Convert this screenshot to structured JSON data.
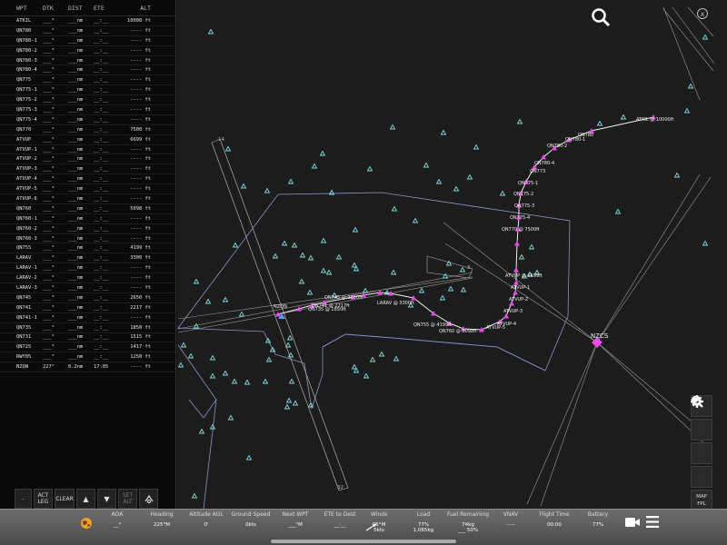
{
  "flight_plan": {
    "columns": [
      "WPT",
      "DTK",
      "DIST",
      "ETE",
      "ALT"
    ],
    "rows": [
      {
        "wpt": "ATKIL",
        "dtk": "___°",
        "dist": "___nm",
        "ete": "__:__",
        "alt": "10000 ft"
      },
      {
        "wpt": "QN780",
        "dtk": "___°",
        "dist": "___nm",
        "ete": "__:__",
        "alt": "---- ft"
      },
      {
        "wpt": "QN780-1",
        "dtk": "___°",
        "dist": "___nm",
        "ete": "__:__",
        "alt": "---- ft"
      },
      {
        "wpt": "QN780-2",
        "dtk": "___°",
        "dist": "___nm",
        "ete": "__:__",
        "alt": "---- ft"
      },
      {
        "wpt": "QN780-3",
        "dtk": "___°",
        "dist": "___nm",
        "ete": "__:__",
        "alt": "---- ft"
      },
      {
        "wpt": "QN780-4",
        "dtk": "___°",
        "dist": "___nm",
        "ete": "__:__",
        "alt": "---- ft"
      },
      {
        "wpt": "QN775",
        "dtk": "___°",
        "dist": "___nm",
        "ete": "__:__",
        "alt": "---- ft"
      },
      {
        "wpt": "QN775-1",
        "dtk": "___°",
        "dist": "___nm",
        "ete": "__:__",
        "alt": "---- ft"
      },
      {
        "wpt": "QN775-2",
        "dtk": "___°",
        "dist": "___nm",
        "ete": "__:__",
        "alt": "---- ft"
      },
      {
        "wpt": "QN775-3",
        "dtk": "___°",
        "dist": "___nm",
        "ete": "__:__",
        "alt": "---- ft"
      },
      {
        "wpt": "QN775-4",
        "dtk": "___°",
        "dist": "___nm",
        "ete": "__:__",
        "alt": "---- ft"
      },
      {
        "wpt": "QN770",
        "dtk": "___°",
        "dist": "___nm",
        "ete": "__:__",
        "alt": "7500 ft"
      },
      {
        "wpt": "ATVUP",
        "dtk": "___°",
        "dist": "___nm",
        "ete": "__:__",
        "alt": "6699 ft"
      },
      {
        "wpt": "ATVUP-1",
        "dtk": "___°",
        "dist": "___nm",
        "ete": "__:__",
        "alt": "---- ft"
      },
      {
        "wpt": "ATVUP-2",
        "dtk": "___°",
        "dist": "___nm",
        "ete": "__:__",
        "alt": "---- ft"
      },
      {
        "wpt": "ATVUP-3",
        "dtk": "___°",
        "dist": "___nm",
        "ete": "__:__",
        "alt": "---- ft"
      },
      {
        "wpt": "ATVUP-4",
        "dtk": "___°",
        "dist": "___nm",
        "ete": "__:__",
        "alt": "---- ft"
      },
      {
        "wpt": "ATVUP-5",
        "dtk": "___°",
        "dist": "___nm",
        "ete": "__:__",
        "alt": "---- ft"
      },
      {
        "wpt": "ATVUP-6",
        "dtk": "___°",
        "dist": "___nm",
        "ete": "__:__",
        "alt": "---- ft"
      },
      {
        "wpt": "QN760",
        "dtk": "___°",
        "dist": "___nm",
        "ete": "__:__",
        "alt": "5098 ft"
      },
      {
        "wpt": "QN760-1",
        "dtk": "___°",
        "dist": "___nm",
        "ete": "__:__",
        "alt": "---- ft"
      },
      {
        "wpt": "QN760-2",
        "dtk": "___°",
        "dist": "___nm",
        "ete": "__:__",
        "alt": "---- ft"
      },
      {
        "wpt": "QN760-3",
        "dtk": "___°",
        "dist": "___nm",
        "ete": "__:__",
        "alt": "---- ft"
      },
      {
        "wpt": "QN755",
        "dtk": "___°",
        "dist": "___nm",
        "ete": "__:__",
        "alt": "4199 ft"
      },
      {
        "wpt": "LARAV",
        "dtk": "___°",
        "dist": "___nm",
        "ete": "__:__",
        "alt": "3300 ft"
      },
      {
        "wpt": "LARAV-1",
        "dtk": "___°",
        "dist": "___nm",
        "ete": "__:__",
        "alt": "---- ft"
      },
      {
        "wpt": "LARAV-2",
        "dtk": "___°",
        "dist": "___nm",
        "ete": "__:__",
        "alt": "---- ft"
      },
      {
        "wpt": "LARAV-3",
        "dtk": "___°",
        "dist": "___nm",
        "ete": "__:__",
        "alt": "---- ft"
      },
      {
        "wpt": "QN745",
        "dtk": "___°",
        "dist": "___nm",
        "ete": "__:__",
        "alt": "2650 ft"
      },
      {
        "wpt": "QN741",
        "dtk": "___°",
        "dist": "___nm",
        "ete": "__:__",
        "alt": "2217 ft"
      },
      {
        "wpt": "QN741-1",
        "dtk": "___°",
        "dist": "___nm",
        "ete": "__:__",
        "alt": "---- ft"
      },
      {
        "wpt": "QN735",
        "dtk": "___°",
        "dist": "___nm",
        "ete": "__:__",
        "alt": "1850 ft"
      },
      {
        "wpt": "QN731",
        "dtk": "___°",
        "dist": "___nm",
        "ete": "__:__",
        "alt": "1515 ft"
      },
      {
        "wpt": "QN725",
        "dtk": "___°",
        "dist": "___nm",
        "ete": "__:__",
        "alt": "1417 ft"
      },
      {
        "wpt": "RWY05",
        "dtk": "___°",
        "dist": "___nm",
        "ete": "__:__",
        "alt": "1250 ft"
      },
      {
        "wpt": "NZQN",
        "dtk": "227°",
        "dist": "0.2nm",
        "ete": "17:05",
        "alt": "---- ft"
      }
    ],
    "buttons": {
      "minus": "-",
      "act_leg_1": "ACT",
      "act_leg_2": "LEG",
      "clear": "CLEAR",
      "set_alt_1": "SET",
      "set_alt_2": "ALT"
    }
  },
  "map": {
    "route_labels": [
      {
        "text": "ATKIL @ 10000ft"
      },
      {
        "text": "QN780"
      },
      {
        "text": "QN780-1"
      },
      {
        "text": "QN780-2"
      },
      {
        "text": "QN780-4"
      },
      {
        "text": "QN773"
      },
      {
        "text": "QN775-1"
      },
      {
        "text": "QN775-2"
      },
      {
        "text": "QN775-3"
      },
      {
        "text": "QN775-4"
      },
      {
        "text": "QN770 @ 7500ft"
      },
      {
        "text": "ATVUP @ 6699ft"
      },
      {
        "text": "ATVUP-1"
      },
      {
        "text": "ATVUP-2"
      },
      {
        "text": "ATVUP-3"
      },
      {
        "text": "ATVUP-4"
      },
      {
        "text": "ATVUP-5"
      },
      {
        "text": "QN755 @ 4199ft"
      },
      {
        "text": "QN760 @ 5098ft"
      },
      {
        "text": "LARAV @ 3300ft"
      },
      {
        "text": "QN745 @ 2650ft"
      },
      {
        "text": "QN741 @ 2217ft"
      },
      {
        "text": "QN735 @ 1850ft"
      },
      {
        "text": "NZQN"
      }
    ],
    "airport": "NZCS",
    "runway_labels": [
      "14",
      "32",
      "3"
    ],
    "map_fpl_1": "MAP",
    "map_fpl_2": "FPL",
    "close": "x"
  },
  "status_bar": {
    "items": [
      {
        "label": "AOA",
        "value": "__°"
      },
      {
        "label": "Heading",
        "value": "225°M"
      },
      {
        "label": "Altitude AGL",
        "value": "0'"
      },
      {
        "label": "Ground Speed",
        "value": "0kts"
      },
      {
        "label": "Next WPT",
        "value": "___°M"
      },
      {
        "label": "ETE to Dest",
        "value": "__:__"
      },
      {
        "label": "Winds",
        "value": "05°M"
      },
      {
        "label": "Load",
        "value": "77%"
      },
      {
        "label": "Fuel Remaining",
        "value": "74kg"
      },
      {
        "label": "VNAV",
        "value": "-----"
      },
      {
        "label": "Flight Time",
        "value": "00:00"
      },
      {
        "label": "Battery",
        "value": "77%"
      }
    ],
    "winds_sub": "5kts",
    "load_sub": "1,065kg",
    "fuel_sub": "___ 50%"
  },
  "colors": {
    "route": "#e84ce8",
    "waypoint_triangle": "#7fd8d8",
    "airspace": "#8a94c8",
    "runway_lines": "#9a9a9a"
  }
}
